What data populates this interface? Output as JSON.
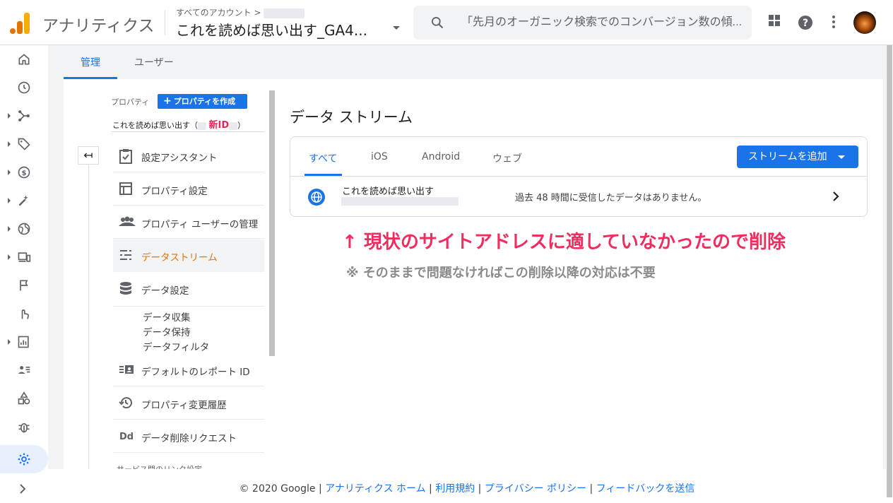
{
  "header": {
    "app_title": "アナリティクス",
    "account_path": "すべてのアカウント >",
    "property_name": "これを読めば思い出す_GA4...",
    "search_placeholder": "「先月のオーガニック検索でのコンバージョン数の傾..."
  },
  "tabs": [
    "管理",
    "ユーザー"
  ],
  "sidebar": {
    "property_label": "プロパティ",
    "create_button": "プロパティを作成",
    "property_name": "これを読めば思い出す（",
    "new_id": "新ID",
    "property_name_close": "）",
    "menu": [
      {
        "label": "設定アシスタント",
        "icon": "checklist-icon"
      },
      {
        "label": "プロパティ設定",
        "icon": "layout-icon"
      },
      {
        "label": "プロパティ ユーザーの管理",
        "icon": "people-icon"
      },
      {
        "label": "データストリーム",
        "icon": "streams-icon"
      },
      {
        "label": "データ設定",
        "icon": "database-icon"
      },
      {
        "label": "デフォルトのレポート ID",
        "icon": "id-card-icon"
      },
      {
        "label": "プロパティ変更履歴",
        "icon": "history-icon"
      },
      {
        "label": "データ削除リクエスト",
        "icon": "dd-icon"
      }
    ],
    "sub_items": [
      "データ収集",
      "データ保持",
      "データフィルタ"
    ],
    "cut_item": "サービス間のリンク設定"
  },
  "data_streams": {
    "title": "データ ストリーム",
    "tabs": [
      "すべて",
      "iOS",
      "Android",
      "ウェブ"
    ],
    "add_button": "ストリームを追加",
    "stream": {
      "name": "これを読めば思い出す",
      "status": "過去 48 時間に受信したデータはありません。"
    }
  },
  "annotations": {
    "main": "↑ 現状のサイトアドレスに適していなかったので削除",
    "note": "※ そのままで問題なければこの削除以降の対応は不要"
  },
  "footer": {
    "copyright": "© 2020 Google | ",
    "links": [
      "アナリティクス ホーム",
      "利用規約",
      "プライバシー ポリシー",
      "フィードバックを送信"
    ],
    "sep": " | "
  },
  "colors": {
    "accent": "#1a73e8",
    "annotation": "#ef2d5e",
    "selected": "#e8710a"
  }
}
